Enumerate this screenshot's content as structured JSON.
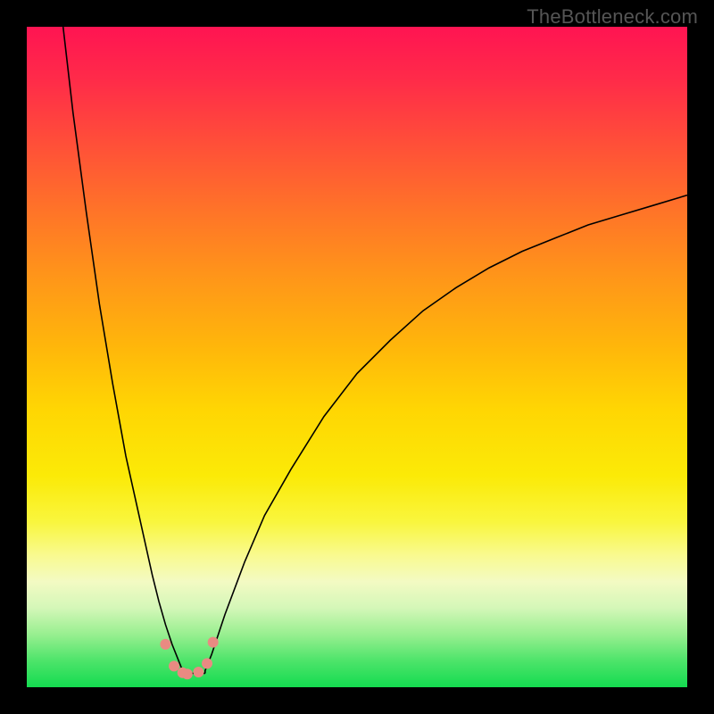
{
  "watermark": "TheBottleneck.com",
  "colors": {
    "dot": "#e98a82",
    "curve": "#000000",
    "bg_top": "#ff1452",
    "bg_bottom": "#14db50"
  },
  "chart_data": {
    "type": "line",
    "title": "",
    "xlabel": "",
    "ylabel": "",
    "xlim": [
      0,
      100
    ],
    "ylim": [
      0,
      100
    ],
    "description": "Bottleneck V-curve: two monotone branches meeting near x≈24 at y≈0; left branch rises steeply toward y=100 as x→5, right branch rises with decreasing slope toward y≈75 as x→100.",
    "series": [
      {
        "name": "left_branch",
        "x": [
          5.5,
          7,
          9,
          11,
          13,
          15,
          17,
          19,
          20,
          21,
          22,
          23,
          23.6
        ],
        "values": [
          100,
          87,
          72,
          58,
          46,
          35,
          26,
          17,
          13,
          9.5,
          6.5,
          4,
          2.5
        ]
      },
      {
        "name": "right_branch",
        "x": [
          27,
          28,
          30,
          33,
          36,
          40,
          45,
          50,
          55,
          60,
          65,
          70,
          75,
          80,
          85,
          90,
          95,
          100
        ],
        "values": [
          2.5,
          5,
          11,
          19,
          26,
          33,
          41,
          47.5,
          52.5,
          57,
          60.5,
          63.5,
          66,
          68,
          70,
          71.5,
          73,
          74.5
        ]
      }
    ],
    "flat_segment": {
      "x": [
        23.6,
        27
      ],
      "y": 2.1
    },
    "points": [
      {
        "x": 21.0,
        "y": 6.5
      },
      {
        "x": 22.3,
        "y": 3.2
      },
      {
        "x": 23.6,
        "y": 2.2
      },
      {
        "x": 24.3,
        "y": 2.0
      },
      {
        "x": 26.0,
        "y": 2.3
      },
      {
        "x": 27.3,
        "y": 3.6
      },
      {
        "x": 28.2,
        "y": 6.8
      }
    ],
    "point_radius_px": 6
  }
}
